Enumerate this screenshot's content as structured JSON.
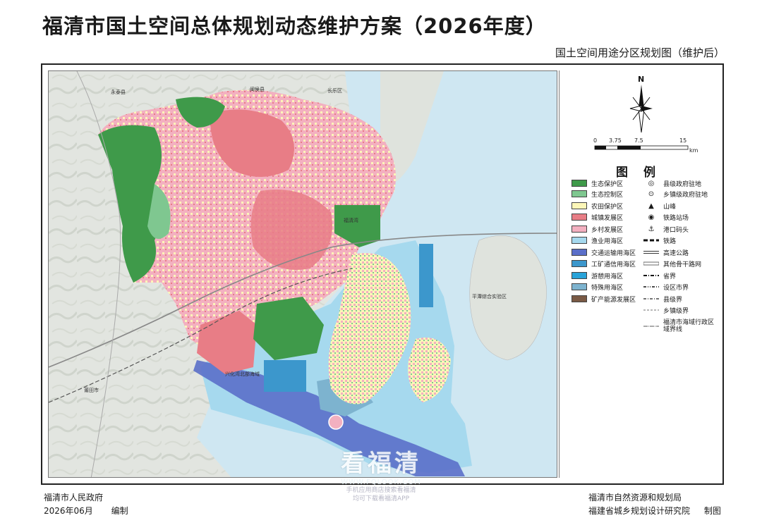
{
  "header": {
    "title": "福清市国土空间总体规划动态维护方案（2026年度）",
    "subtitle": "国土空间用途分区规划图（维护后）"
  },
  "map": {
    "colors": {
      "ecological_protection": "#3f9a4a",
      "ecological_control": "#7fc790",
      "farmland": "#fcf6b8",
      "urban": "#e87d86",
      "rural": "#f3b0c0",
      "fishery_sea": "#a6d9ee",
      "transport_sea": "#5b6fc9",
      "industrial_sea": "#3c97cc",
      "leisure_sea": "#29a3d9",
      "special_sea": "#7db3cf",
      "mineral": "#7a5a45",
      "open_sea": "#cfe7f2",
      "land_gray": "#e2e5e0"
    },
    "labels": {
      "changle": "长乐区",
      "minhou": "闽侯县",
      "yongtai": "永泰县",
      "putian": "莆田市",
      "fuqing_bay": "福清湾",
      "pingtan": "平潭综合实验区",
      "xinghua_bay": "兴化湾北部海域"
    },
    "north": "N",
    "scale": {
      "ticks": [
        "0",
        "3.75",
        "7.5",
        "15"
      ],
      "unit": "km"
    }
  },
  "legend": {
    "title": "图例",
    "zones": [
      {
        "label": "生态保护区",
        "color": "#3f9a4a"
      },
      {
        "label": "生态控制区",
        "color": "#7fc790"
      },
      {
        "label": "农田保护区",
        "color": "#fcf6b8"
      },
      {
        "label": "城镇发展区",
        "color": "#e87d86"
      },
      {
        "label": "乡村发展区",
        "color": "#f3b0c0"
      },
      {
        "label": "渔业用海区",
        "color": "#a6d9ee"
      },
      {
        "label": "交通运输用海区",
        "color": "#5b6fc9"
      },
      {
        "label": "工矿通信用海区",
        "color": "#3c97cc"
      },
      {
        "label": "游憩用海区",
        "color": "#29a3d9"
      },
      {
        "label": "特殊用海区",
        "color": "#7db3cf"
      },
      {
        "label": "矿产能源发展区",
        "color": "#7a5a45"
      }
    ],
    "symbols": [
      {
        "label": "县级政府驻地",
        "icon": "double-circle-icon"
      },
      {
        "label": "乡镇级政府驻地",
        "icon": "dot-circle-icon"
      },
      {
        "label": "山峰",
        "icon": "triangle-icon"
      },
      {
        "label": "铁路站场",
        "icon": "station-icon"
      },
      {
        "label": "港口码头",
        "icon": "anchor-icon"
      },
      {
        "label": "铁路",
        "icon": "railway-line-icon"
      },
      {
        "label": "高速公路",
        "icon": "expressway-line-icon"
      },
      {
        "label": "其他骨干路网",
        "icon": "road-line-icon"
      },
      {
        "label": "省界",
        "icon": "province-boundary-icon"
      },
      {
        "label": "设区市界",
        "icon": "city-boundary-icon"
      },
      {
        "label": "县级界",
        "icon": "county-boundary-icon"
      },
      {
        "label": "乡镇级界",
        "icon": "township-boundary-icon"
      },
      {
        "label": "福清市海域行政区域界线",
        "icon": "sea-boundary-icon"
      }
    ]
  },
  "footer": {
    "left_org": "福清市人民政府",
    "left_date": "2026年06月",
    "left_action": "编制",
    "right_org1": "福清市自然资源和规划局",
    "right_org2": "福建省城乡规划设计研究院",
    "right_action": "制图"
  },
  "watermark": {
    "brand": "看福清",
    "url": "WWW.FQLOOK.COM",
    "line1": "手机应用商店搜索看福清",
    "line2": "均可下载看福清APP"
  }
}
